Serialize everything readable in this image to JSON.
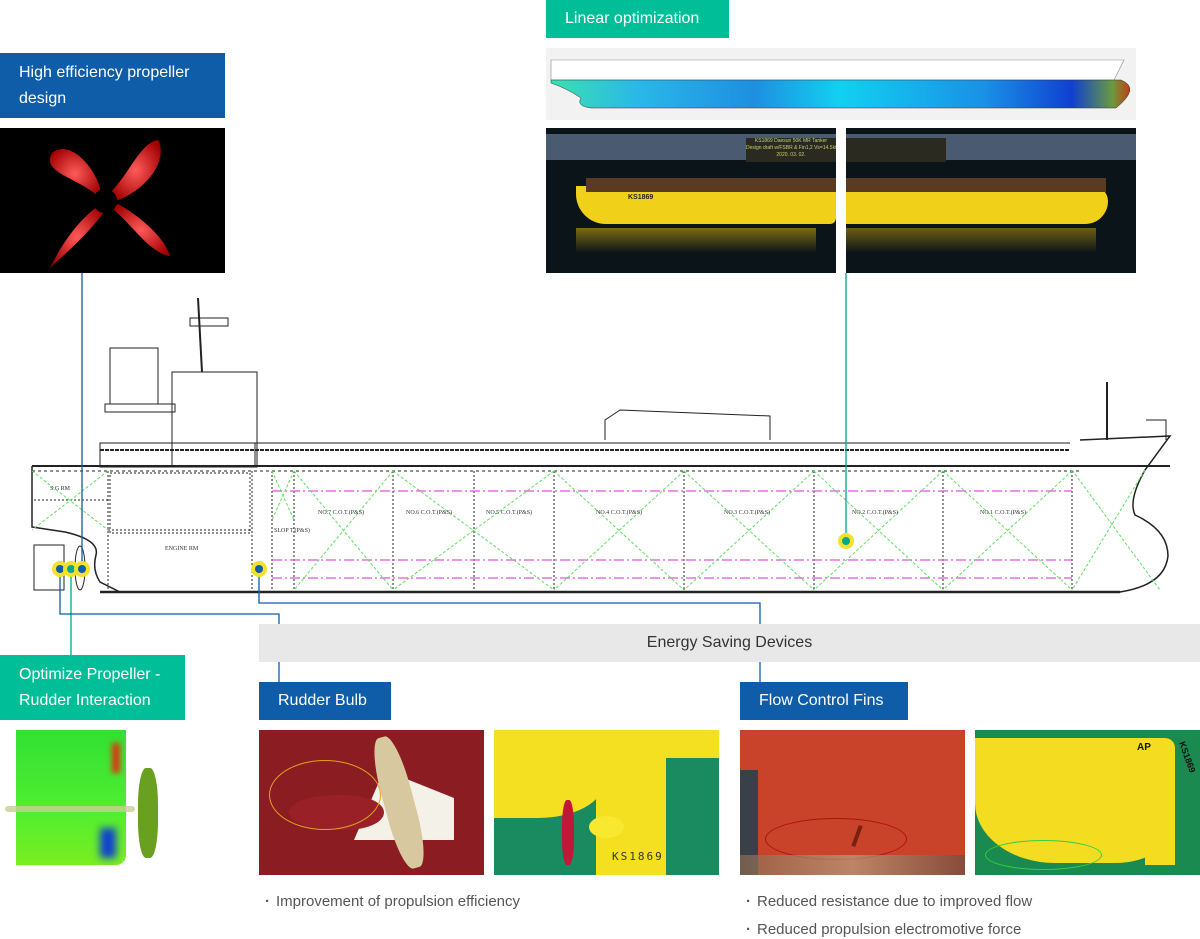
{
  "labels": {
    "propeller_design": "High efficiency propeller design",
    "linear_optimization": "Linear optimization",
    "propeller_rudder": "Optimize Propeller -Rudder Interaction",
    "energy_saving_devices": "Energy Saving Devices",
    "rudder_bulb": "Rudder Bulb",
    "flow_control_fins": "Flow Control Fins"
  },
  "images": {
    "propeller_render": "propeller-render",
    "hull_pressure_contour": "hull-pressure-contour",
    "model_test_tank_left_caption": "KS1869 Daesun 50K MR Tanker\nDesign draft w/FSBR & Fin1,2 Vs=14.5kts\n2020. 03. 02.",
    "model_hull_marking": "KS1869",
    "rudder_model_marking": "KS1869",
    "fins_model_marking_ap": "AP",
    "fins_model_marking": "KS1869"
  },
  "ship_drawing": {
    "compartments": [
      "S.G RM",
      "ENGINE RM",
      "NO.7 C.O.T.(P&S)",
      "NO.6 C.O.T.(P&S)",
      "NO.5 C.O.T.(P&S)",
      "NO.4 C.O.T.(P&S)",
      "NO.3 C.O.T.(P&S)",
      "NO.2 C.O.T.(P&S)",
      "NO.1 C.O.T.(P&S)",
      "SLOP T.(P&S)"
    ]
  },
  "rudder_bulb_bullets": [
    "Improvement of propulsion efficiency"
  ],
  "flow_fins_bullets": [
    "Reduced resistance due to improved flow",
    "Reduced propulsion electromotive force"
  ],
  "colors": {
    "label_blue": "#0f5ca8",
    "label_green": "#00bf98",
    "marker_yellow": "#f5e12a",
    "esd_bar": "#e8e8e8"
  }
}
